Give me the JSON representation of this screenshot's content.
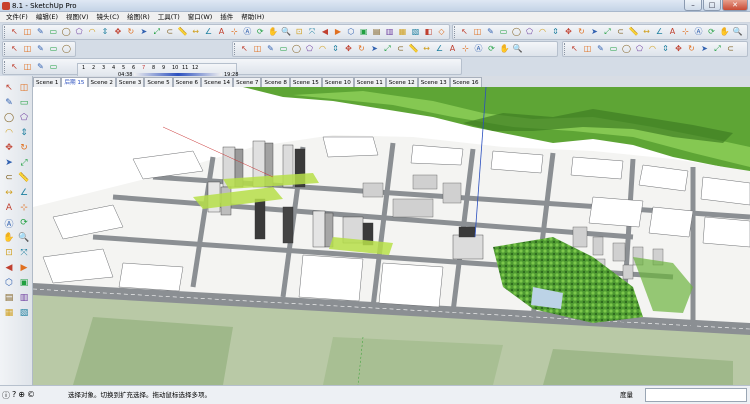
{
  "window": {
    "title": "8.1 - SketchUp Pro",
    "min": "–",
    "max": "□",
    "close": "✕"
  },
  "menu": [
    "文件(F)",
    "编辑(E)",
    "视图(V)",
    "镜头(C)",
    "绘图(R)",
    "工具(T)",
    "窗口(W)",
    "插件",
    "帮助(H)"
  ],
  "shadow": {
    "months": [
      "1",
      "2",
      "3",
      "4",
      "5",
      "6",
      "7",
      "8",
      "9",
      "10",
      "11",
      "12"
    ],
    "time_start": "04:38",
    "time_end": "19:28"
  },
  "scenes": {
    "active": 1,
    "tabs": [
      "Scene 1",
      "后期 15",
      "Scene 2",
      "Scene 3",
      "Scene 5",
      "Scene 6",
      "Scene 14",
      "Scene 7",
      "Scene 8",
      "Scene 15",
      "Scene 10",
      "Scene 11",
      "Scene 12",
      "Scene 13",
      "Scene 16"
    ]
  },
  "status": {
    "message": "选择对象。切换到扩充选择。拖动鼠标选择多项。",
    "measure_label": "度量",
    "measure_value": ""
  },
  "colors": {
    "accent": "#2a4fbf",
    "terrain": "#6cb33f",
    "ground": "#b7c6a4",
    "road": "#8b8f93"
  },
  "icons": {
    "toolbar_row1": [
      "select-icon",
      "eraser-icon",
      "pencil-icon",
      "rectangle-icon",
      "circle-icon",
      "polygon-icon",
      "arc-icon",
      "push-pull-icon",
      "move-icon",
      "rotate-icon",
      "follow-me-icon",
      "scale-icon",
      "offset-icon",
      "tape-icon",
      "dimension-icon",
      "protractor-icon",
      "text-icon",
      "axes-icon",
      "3d-text-icon",
      "orbit-icon",
      "pan-icon",
      "zoom-icon",
      "zoom-window-icon",
      "zoom-extents-icon",
      "previous-icon",
      "next-icon",
      "iso-view-icon",
      "top-view-icon",
      "front-view-icon",
      "right-view-icon",
      "back-view-icon",
      "left-view-icon",
      "xray-icon",
      "wireframe-icon",
      "hidden-line-icon",
      "shaded-icon",
      "textured-icon",
      "monochrome-icon"
    ],
    "toolbar_row2": [
      "component-icon",
      "paint-icon",
      "section-icon",
      "layer-icon",
      "walk-icon",
      "look-icon",
      "position-camera-icon",
      "sandbox-icon",
      "smoove-icon",
      "stamp-icon",
      "drape-icon",
      "add-detail-icon",
      "flip-edge-icon",
      "solid-union-icon",
      "solid-subtract-icon",
      "solid-trim-icon",
      "solid-split-icon",
      "warehouse-icon",
      "share-model-icon",
      "google-earth-icon",
      "photo-match-icon",
      "style-icon"
    ],
    "toolbar_row3": [
      "arc-tool-icon",
      "bezier-icon",
      "spline-icon",
      "loft-icon",
      "weld-icon",
      "round-corner-icon",
      "extrude-icon",
      "joint-push-icon",
      "tools-icon",
      "round-icon",
      "smooth-icon",
      "curve-icon",
      "soap-icon",
      "grid-icon",
      "fredo-icon",
      "make-face-icon",
      "lines-icon",
      "ruby-icon",
      "thru-icon"
    ],
    "left_tools": [
      "select-icon",
      "eraser-icon",
      "pencil-icon",
      "paint-icon",
      "rectangle-icon",
      "line-icon",
      "circle-icon",
      "arc-icon",
      "polygon-icon",
      "freehand-icon",
      "move-icon",
      "push-pull-icon",
      "rotate-icon",
      "follow-me-icon",
      "scale-icon",
      "offset-icon",
      "tape-icon",
      "dimension-icon",
      "protractor-icon",
      "text-icon",
      "axes-icon",
      "3d-text-icon",
      "orbit-icon",
      "pan-icon",
      "zoom-icon",
      "zoom-window-icon",
      "zoom-extents-icon",
      "previous-icon",
      "position-camera-icon",
      "walk-icon",
      "look-icon",
      "section-icon"
    ],
    "status_icons": [
      "info-icon",
      "help-icon",
      "geo-icon"
    ]
  }
}
